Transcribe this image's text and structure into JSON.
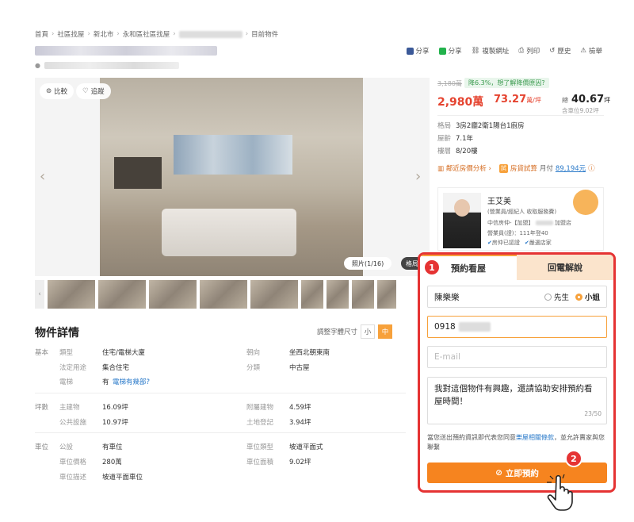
{
  "breadcrumb": {
    "items": [
      "首頁",
      "社區找屋",
      "新北市",
      "永和區社區找屋"
    ],
    "current": "目前物件"
  },
  "share_bar": {
    "facebook": "分享",
    "line": "分享",
    "copy": "複製網址",
    "print": "列印",
    "history": "歷史",
    "report": "檢舉"
  },
  "photo": {
    "compare": "比較",
    "track": "追蹤",
    "count": "照片(1/16)",
    "tab2": "格局"
  },
  "details": {
    "title": "物件詳情",
    "fontsize_label": "調整字體尺寸",
    "fontsize_small": "小",
    "fontsize_medium": "中",
    "basic": {
      "section": "基本",
      "type_label": "類型",
      "type_value": "住宅/電梯大廈",
      "usage_label": "法定用途",
      "usage_value": "集合住宅",
      "elevator_label": "電梯",
      "elevator_value": "有",
      "elevator_link": "電梯有幾部?",
      "facing_label": "朝向",
      "facing_value": "坐西北朝東南",
      "category_label": "分類",
      "category_value": "中古屋"
    },
    "area": {
      "section": "坪數",
      "main_label": "主建物",
      "main_value": "16.09坪",
      "public_label": "公共設施",
      "public_value": "10.97坪",
      "annex_label": "附屬建物",
      "annex_value": "4.59坪",
      "land_label": "土地登記",
      "land_value": "3.94坪"
    },
    "parking": {
      "section": "車位",
      "presence_label": "公設",
      "presence_value": "有車位",
      "price_label": "車位價格",
      "price_value": "280萬",
      "desc_label": "車位描述",
      "desc_value": "坡道平面車位",
      "type_label": "車位類型",
      "type_value": "坡道平面式",
      "area_label": "車位面積",
      "area_value": "9.02坪"
    }
  },
  "price": {
    "old": "3,180萬",
    "drop": "降6.3%，想了解降價原因?",
    "total": "2,980萬",
    "unit_price": "73.27",
    "unit_suffix": "萬/坪",
    "area_prefix": "總",
    "area_value": "40.67",
    "area_unit": "坪",
    "area_sub": "含車位9.02坪",
    "layout_label": "格局",
    "layout_value": "3房2廳2衛1陽台1廚房",
    "age_label": "屋齡",
    "age_value": "7.1年",
    "floor_label": "樓層",
    "floor_value": "8/20樓",
    "analysis": "鄰近房價分析",
    "loan_label": "房貸試算",
    "loan_value_prefix": "月付",
    "loan_value": "89,194元"
  },
  "agent": {
    "name": "王艾美",
    "role": "(營業員/經紀人 收取服務費)",
    "branch": "中信房仲-【加盟】",
    "branch_suffix": "加盟店",
    "license": "營業員(證)：111年登40",
    "tag1": "房仲已認證",
    "tag2": "嚴選店家"
  },
  "form": {
    "tab_booking": "預約看屋",
    "tab_callback": "回電解說",
    "name_value": "陳樂樂",
    "gender_male": "先生",
    "gender_female": "小姐",
    "phone_value": "0918",
    "email_placeholder": "E-mail",
    "message": "我對這個物件有興趣，還請協助安排預約看屋時間！",
    "counter": "23/50",
    "consent_prefix": "當您送出預約資訊即代表您同意",
    "consent_link": "樂屋相關條款",
    "consent_suffix": "，並允許賣家與您聯繫",
    "submit": "立即預約"
  },
  "steps": {
    "one": "1",
    "two": "2"
  },
  "colors": {
    "accent": "#f6841f",
    "highlight": "#e53333",
    "price": "#e5432f",
    "link": "#2979c9"
  }
}
